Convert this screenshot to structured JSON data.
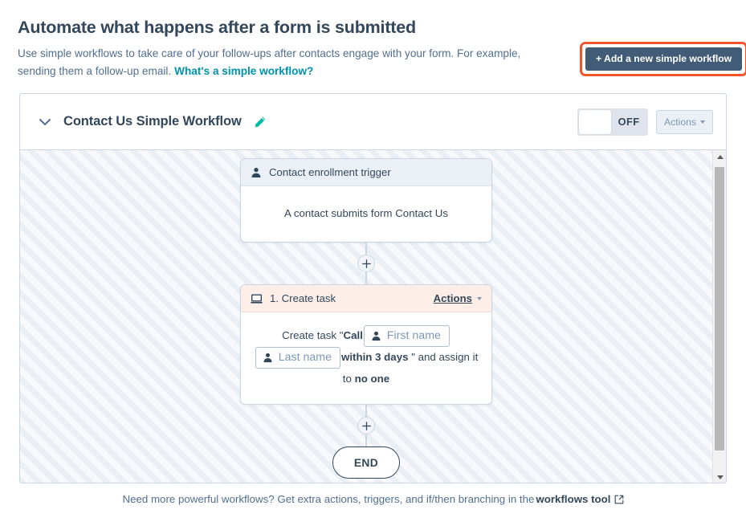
{
  "header": {
    "title": "Automate what happens after a form is submitted",
    "description_1": "Use simple workflows to take care of your follow-ups after contacts engage with your form. For example,",
    "description_2": "sending them a follow-up email.",
    "help_link": "What's a simple workflow?",
    "cta_label": "+ Add a new simple workflow",
    "cta_bg": "#425b76",
    "cta_highlight": "#f2552c",
    "link_color": "#0091ae"
  },
  "workflow": {
    "collapse_icon": "chevron-down-icon",
    "name": "Contact Us Simple Workflow",
    "edit_icon": "pencil-icon",
    "edit_icon_color": "#00bda5",
    "toggle_state": "OFF",
    "actions_label": "Actions"
  },
  "canvas": {
    "trigger": {
      "icon": "contact-person-icon",
      "header": "Contact enrollment trigger",
      "body": "A contact submits form Contact Us",
      "header_bg": "#eaf0f6"
    },
    "add_step_1": "+",
    "action": {
      "icon": "task-monitor-icon",
      "header": "1. Create task",
      "actions_label": "Actions",
      "header_bg": "#fdeee8",
      "body": {
        "prefix": "Create task \"",
        "bold_call": "Call",
        "token_1": "First name",
        "token_2": "Last name",
        "bold_due": "within 3 days",
        "middle": "\" and assign it to",
        "bold_assignee": "no one"
      }
    },
    "add_step_2": "+",
    "end_label": "END",
    "scrollbar": {
      "up_icon": "scroll-up-arrow-icon",
      "down_icon": "scroll-down-arrow-icon"
    }
  },
  "footer": {
    "text": "Need more powerful workflows? Get extra actions, triggers, and if/then branching in the",
    "link": "workflows tool",
    "external_icon": "external-link-icon"
  }
}
